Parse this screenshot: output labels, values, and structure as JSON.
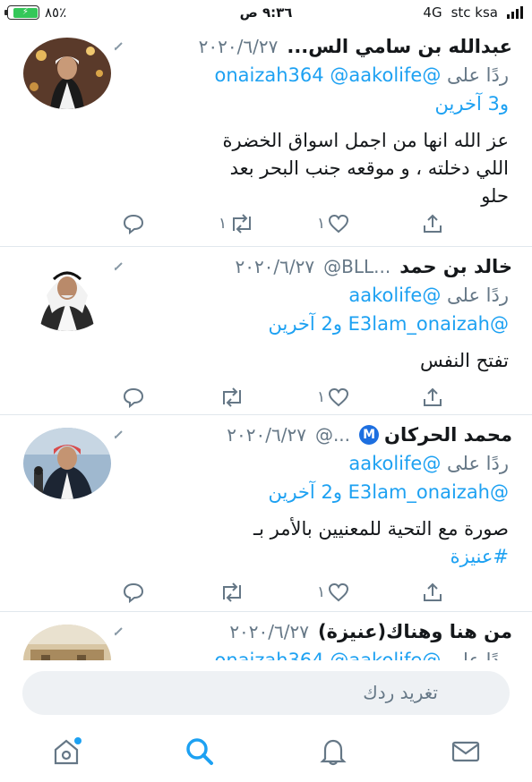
{
  "status_bar": {
    "battery": "٨٥٪",
    "time": "٩:٣٦ ص",
    "network": "4G",
    "carrier": "stc ksa"
  },
  "replying_to_label": "ردًا على",
  "tweets": [
    {
      "name": "عبدالله بن سامي الس...",
      "handle": "",
      "date": "٢٠٢٠/٦/٢٧",
      "reply_handles": "@onaizah364 @aakolife",
      "reply_others": "و3 آخرين",
      "body_lines": [
        "عز الله انها من اجمل اسواق الخضرة",
        "اللي دخلته ، و موقعه جنب البحر بعد",
        "حلو"
      ],
      "replies": "",
      "retweets": "١",
      "likes": "١"
    },
    {
      "name": "خالد بن حمد",
      "handle": "@BLL...",
      "date": "٢٠٢٠/٦/٢٧",
      "reply_handles": "@aakolife",
      "reply_line2": "@E3lam_onaizah و2 آخرين",
      "body_lines": [
        "تفتح النفس"
      ],
      "replies": "",
      "retweets": "",
      "likes": "١"
    },
    {
      "name": "محمد الحركان",
      "verified_badge": "M",
      "handle": "@...",
      "date": "٢٠٢٠/٦/٢٧",
      "reply_handles": "@aakolife",
      "reply_line2": "@E3lam_onaizah و2 آخرين",
      "body_lines": [
        "صورة مع التحية للمعنيين بالأمر بـ"
      ],
      "hashtag": "#عنيزة",
      "replies": "",
      "retweets": "",
      "likes": "١"
    },
    {
      "name": "من هنا وهناك(عنيزة)",
      "date": "٢٠٢٠/٦/٢٧",
      "partial_reply": "@onaizah364 @aakolife"
    }
  ],
  "composer": {
    "placeholder": "تغريد ردك"
  },
  "icons": [
    "home-icon",
    "search-icon",
    "notifications-icon",
    "messages-icon",
    "reply-icon",
    "retweet-icon",
    "like-icon",
    "share-icon",
    "chevron-down-icon"
  ],
  "colors": {
    "accent": "#1da1f2",
    "muted": "#657786",
    "battery": "#34c759",
    "verified": "#1d6fe0"
  }
}
